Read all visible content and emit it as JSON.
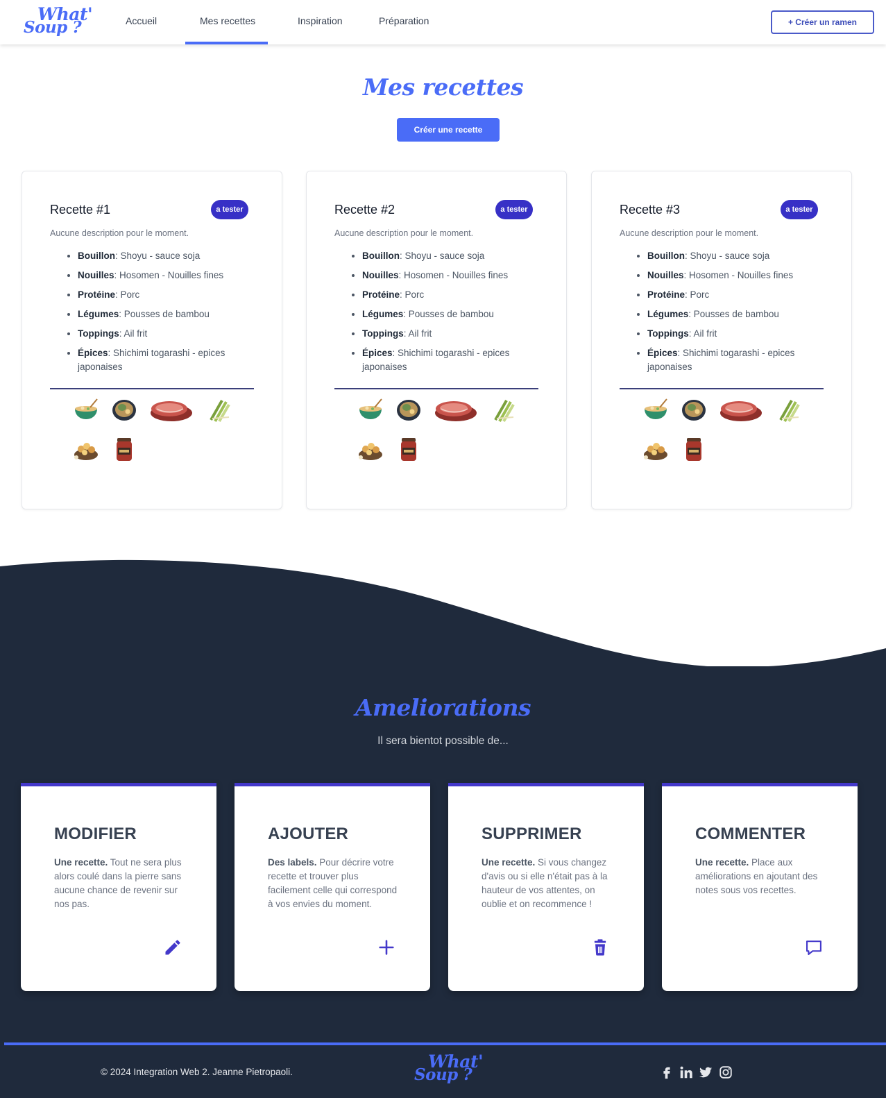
{
  "header": {
    "logo_line1": "What'",
    "logo_line2": "Soup ?",
    "nav": [
      "Accueil",
      "Mes recettes",
      "Inspiration",
      "Préparation"
    ],
    "active_nav": "Mes recettes",
    "create_ramen": "+ Créer un ramen"
  },
  "main": {
    "title": "Mes recettes",
    "create_button": "Créer une recette",
    "recipes": [
      {
        "title": "Recette #1",
        "badge": "a tester",
        "description": "Aucune description pour le moment.",
        "ingredients": [
          {
            "label": "Bouillon",
            "value": ": Shoyu - sauce soja"
          },
          {
            "label": "Nouilles",
            "value": ": Hosomen - Nouilles fines"
          },
          {
            "label": "Protéine",
            "value": ": Porc"
          },
          {
            "label": "Légumes",
            "value": ": Pousses de bambou"
          },
          {
            "label": "Toppings",
            "value": ": Ail frit"
          },
          {
            "label": "Épices",
            "value": ": Shichimi togarashi - epices japonaises"
          }
        ],
        "icons": [
          "broth-bowl-icon",
          "noodle-bowl-icon",
          "pork-slices-icon",
          "bamboo-shoots-icon",
          "fried-garlic-icon",
          "spice-jar-icon"
        ]
      },
      {
        "title": "Recette #2",
        "badge": "a tester",
        "description": "Aucune description pour le moment.",
        "ingredients": [
          {
            "label": "Bouillon",
            "value": ": Shoyu - sauce soja"
          },
          {
            "label": "Nouilles",
            "value": ": Hosomen - Nouilles fines"
          },
          {
            "label": "Protéine",
            "value": ": Porc"
          },
          {
            "label": "Légumes",
            "value": ": Pousses de bambou"
          },
          {
            "label": "Toppings",
            "value": ": Ail frit"
          },
          {
            "label": "Épices",
            "value": ": Shichimi togarashi - epices japonaises"
          }
        ],
        "icons": [
          "broth-bowl-icon",
          "noodle-bowl-icon",
          "pork-slices-icon",
          "bamboo-shoots-icon",
          "fried-garlic-icon",
          "spice-jar-icon"
        ]
      },
      {
        "title": "Recette #3",
        "badge": "a tester",
        "description": "Aucune description pour le moment.",
        "ingredients": [
          {
            "label": "Bouillon",
            "value": ": Shoyu - sauce soja"
          },
          {
            "label": "Nouilles",
            "value": ": Hosomen - Nouilles fines"
          },
          {
            "label": "Protéine",
            "value": ": Porc"
          },
          {
            "label": "Légumes",
            "value": ": Pousses de bambou"
          },
          {
            "label": "Toppings",
            "value": ": Ail frit"
          },
          {
            "label": "Épices",
            "value": ": Shichimi togarashi - epices japonaises"
          }
        ],
        "icons": [
          "broth-bowl-icon",
          "noodle-bowl-icon",
          "pork-slices-icon",
          "bamboo-shoots-icon",
          "fried-garlic-icon",
          "spice-jar-icon"
        ]
      }
    ]
  },
  "improvements": {
    "title": "Ameliorations",
    "subtitle": "Il sera bientot possible de...",
    "cards": [
      {
        "heading": "MODIFIER",
        "lead": "Une recette.",
        "text": " Tout ne sera plus alors coulé dans la pierre sans aucune chance de revenir sur nos pas.",
        "icon": "pencil-icon"
      },
      {
        "heading": "AJOUTER",
        "lead": "Des labels.",
        "text": " Pour décrire votre recette et trouver plus facilement celle qui correspond à vos envies du moment.",
        "icon": "plus-icon"
      },
      {
        "heading": "SUPPRIMER",
        "lead": "Une recette.",
        "text": " Si vous changez d'avis ou si elle n'était pas à la hauteur de vos attentes, on oublie et on recommence !",
        "icon": "trash-icon"
      },
      {
        "heading": "COMMENTER",
        "lead": "Une recette.",
        "text": " Place aux améliorations en ajoutant des notes sous vos recettes.",
        "icon": "comment-icon"
      }
    ]
  },
  "footer": {
    "copyright": "© 2024 Integration Web 2. Jeanne Pietropaoli.",
    "logo_line1": "What'",
    "logo_line2": "Soup ?",
    "social": [
      "facebook-icon",
      "linkedin-icon",
      "twitter-icon",
      "instagram-icon"
    ]
  },
  "colors": {
    "accent": "#4a6cf7",
    "badge": "#3730c6",
    "dark_bg": "#1f2a3c",
    "card_border_top": "#4338ca"
  }
}
